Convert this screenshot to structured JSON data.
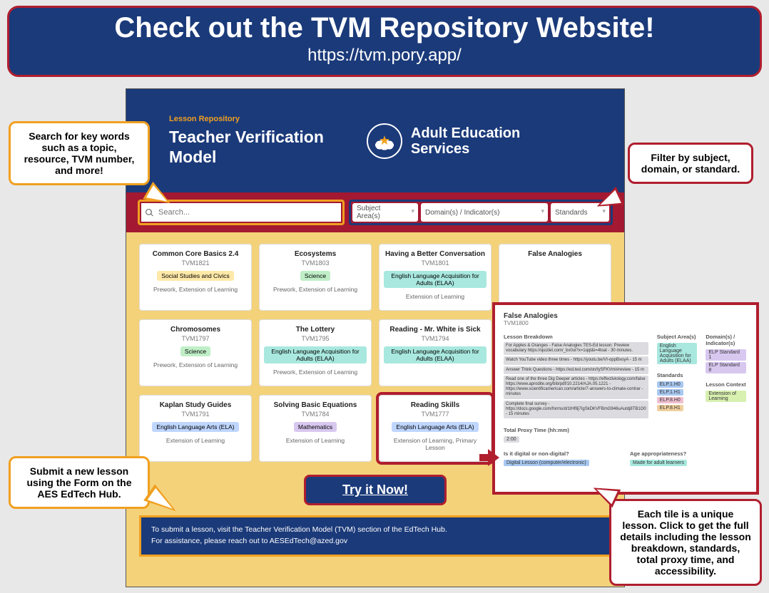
{
  "banner": {
    "title": "Check out the TVM Repository Website!",
    "url": "https://tvm.pory.app/"
  },
  "callouts": {
    "search": "Search for key words such as a topic, resource, TVM number, and more!",
    "filter": "Filter by subject, domain, or standard.",
    "submit": "Submit a new lesson using the Form on the AES EdTech Hub.",
    "tile": "Each tile is a unique lesson. Click to get the full details including the lesson breakdown, standards, total proxy time, and accessibility."
  },
  "site": {
    "top_label": "Lesson Repository",
    "title_line1": "Teacher Verification",
    "title_line2": "Model",
    "aes_line1": "Adult Education",
    "aes_line2": "Services"
  },
  "search": {
    "placeholder": "Search..."
  },
  "filters": {
    "subject": "Subject Area(s)",
    "domain": "Domain(s) / Indicator(s)",
    "standards": "Standards"
  },
  "tiles": [
    {
      "title": "Common Core Basics 2.4",
      "id": "TVM1821",
      "tag": "Social Studies and Civics",
      "tag_class": "tag-yellow",
      "sub": "Prework, Extension of Learning"
    },
    {
      "title": "Ecosystems",
      "id": "TVM1803",
      "tag": "Science",
      "tag_class": "tag-green",
      "sub": "Prework, Extension of Learning"
    },
    {
      "title": "Having a Better Conversation",
      "id": "TVM1801",
      "tag": "English Language Acquisition for Adults (ELAA)",
      "tag_class": "tag-teal",
      "sub": "Extension of Learning"
    },
    {
      "title": "False Analogies",
      "id": "",
      "tag": "",
      "tag_class": "",
      "sub": ""
    },
    {
      "title": "Chromosomes",
      "id": "TVM1797",
      "tag": "Science",
      "tag_class": "tag-green",
      "sub": "Prework, Extension of Learning"
    },
    {
      "title": "The Lottery",
      "id": "TVM1795",
      "tag": "English Language Acquisition for Adults (ELAA)",
      "tag_class": "tag-teal",
      "sub": "Prework, Extension of Learning"
    },
    {
      "title": "Reading - Mr. White is Sick",
      "id": "TVM1794",
      "tag": "English Language Acquisition for Adults (ELAA)",
      "tag_class": "tag-teal",
      "sub": ""
    },
    {
      "title": "",
      "id": "",
      "tag": "",
      "tag_class": "",
      "sub": ""
    },
    {
      "title": "Kaplan Study Guides",
      "id": "TVM1791",
      "tag": "English Language Arts (ELA)",
      "tag_class": "tag-blue",
      "sub": "Extension of Learning"
    },
    {
      "title": "Solving Basic Equations",
      "id": "TVM1784",
      "tag": "Mathematics",
      "tag_class": "tag-purple",
      "sub": "Extension of Learning"
    },
    {
      "title": "Reading Skills",
      "id": "TVM1777",
      "tag": "English Language Arts (ELA)",
      "tag_class": "tag-blue",
      "sub": "Extension of Learning, Primary Lesson",
      "highlight": true
    }
  ],
  "try_now": "Try it Now!",
  "submit_banner": {
    "line1": "To submit a lesson, visit the Teacher Verification Model (TVM) section of the EdTech Hub.",
    "line2": "For assistance, please reach out to AESEdTech@azed.gov"
  },
  "detail": {
    "title": "False Analogies",
    "id": "TVM1800",
    "sections": {
      "breakdown_label": "Lesson Breakdown",
      "breakdown_items": [
        "For Apples & Oranges - False Analogies TES-Ed lesson: Preview vocabulary https://quizlet.com/_bx0ui?x=1qqt&i=4loat - 30 minutes.",
        "Watch YouTube video three times - https://youtu.be/VI-oppBxoyA - 15 m",
        "Answer Think Questions - https://ed.ted.com/on/IySFKVmi#review - 15 m",
        "Read one of the three Dig Deeper articles - https://effectiviology.com/false https://www.aprodite.org/bib/pdf/10.2214/AJA.05.1221 - https://www.scientificamerican.com/article/7-answers-to-climate-contrar - minutes",
        "Complete final survey - https://docs.google.com/forms/d/1tHf8j7IgSkDKVFBmG946uAutdj8TB1O0 - 15 minutes"
      ],
      "subject_label": "Subject Area(s)",
      "subject_value": "English Language Acquisition for Adults (ELAA)",
      "domain_label": "Domain(s) / Indicator(s)",
      "domain_values": [
        "ELP Standard 1",
        "ELP Standard 8"
      ],
      "standards_label": "Standards",
      "standards_values": [
        "ELP.1.H0",
        "ELP.1.H1",
        "ELP.8.H0",
        "ELP.8.H1"
      ],
      "context_label": "Lesson Context",
      "context_value": "Extension of Learning",
      "proxy_label": "Total Proxy Time (hh:mm)",
      "proxy_value": "2:00",
      "digital_label": "Is it digital or non-digital?",
      "digital_value": "Digital Lesson (computer/electronic)",
      "age_label": "Age appropriateness?",
      "age_value": "Made for adult learners"
    }
  }
}
